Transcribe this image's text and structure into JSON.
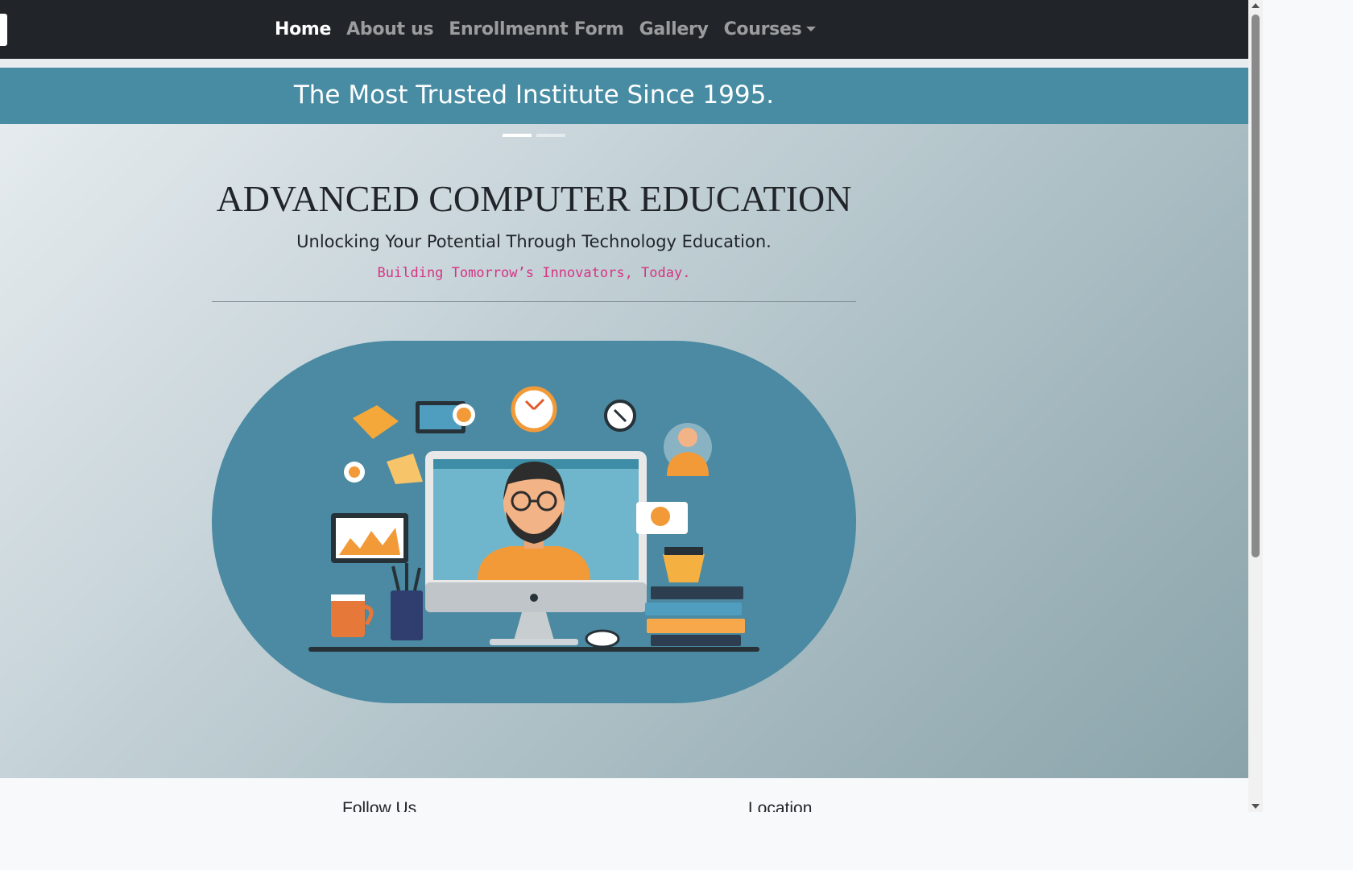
{
  "nav": {
    "items": [
      {
        "label": "Home",
        "active": true
      },
      {
        "label": "About us",
        "active": false
      },
      {
        "label": "Enrollmennt Form",
        "active": false
      },
      {
        "label": "Gallery",
        "active": false
      },
      {
        "label": "Courses",
        "active": false,
        "dropdown": true
      }
    ]
  },
  "hero": {
    "banner_text": "The Most Trusted Institute Since 1995.",
    "carousel_slide": 1,
    "carousel_slides": 2,
    "title": "ADVANCED COMPUTER EDUCATION",
    "subtitle": "Unlocking Your Potential Through Technology Education.",
    "tagline": "Building Tomorrow’s Innovators, Today."
  },
  "footer": {
    "follow_heading": "Follow Us",
    "location_heading": "Location"
  },
  "colors": {
    "navbar_bg": "#212529",
    "banner_bg": "#478ca3",
    "tagline": "#d63384",
    "illustration_bg": "#4b8aa2"
  }
}
